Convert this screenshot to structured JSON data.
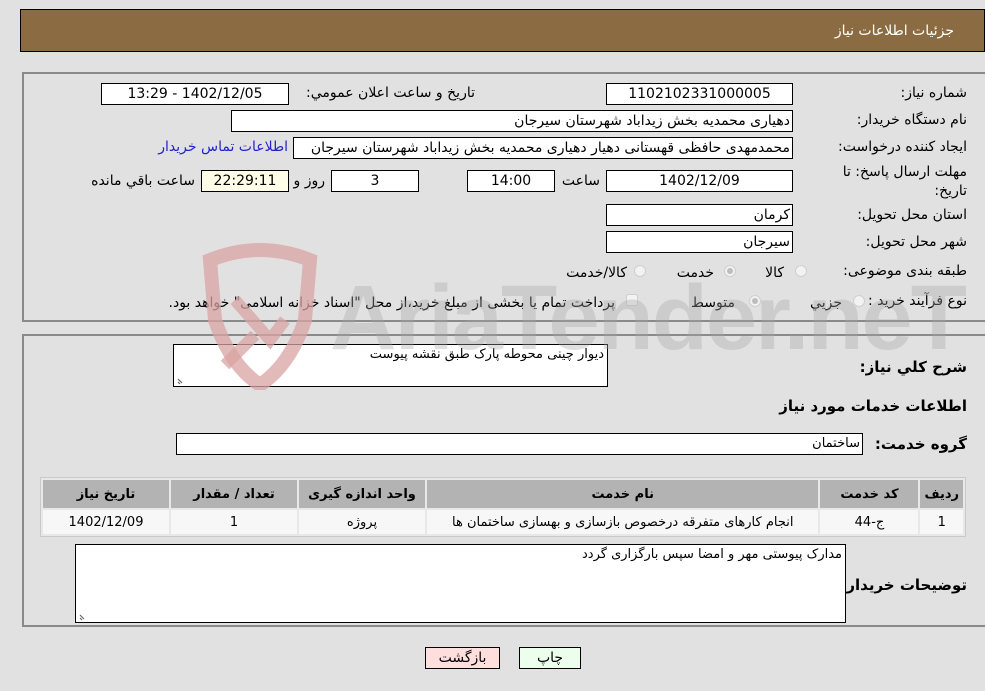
{
  "header": {
    "title": "جزئیات اطلاعات نیاز"
  },
  "form": {
    "need_number": {
      "label": "شماره نیاز:",
      "value": "1102102331000005"
    },
    "announce_datetime": {
      "label": "تاریخ و ساعت اعلان عمومي:",
      "value": "1402/12/05 - 13:29"
    },
    "buyer_org": {
      "label": "نام دستگاه خريدار:",
      "value": "دهیاری محمدیه بخش زیداباد شهرستان سیرجان"
    },
    "requester": {
      "label": "ایجاد کننده درخواست:",
      "value": "محمدمهدی حافظی قهستانی دهیار دهیاری محمدیه بخش زیداباد شهرستان سیرجان"
    },
    "buyer_contact_link": "اطلاعات تماس خریدار",
    "deadline": {
      "label": "مهلت ارسال پاسخ: تا تاریخ:",
      "date": "1402/12/09",
      "time_label": "ساعت",
      "time": "14:00",
      "days": "3",
      "days_label": "روز و",
      "remaining": "22:29:11",
      "remaining_label": "ساعت باقي مانده"
    },
    "province": {
      "label": "استان محل تحویل:",
      "value": "کرمان"
    },
    "city": {
      "label": "شهر محل تحویل:",
      "value": "سیرجان"
    },
    "category": {
      "label": "طبقه بندی موضوعی:",
      "options": [
        {
          "label": "کالا",
          "checked": false
        },
        {
          "label": "خدمت",
          "checked": true
        },
        {
          "label": "کالا/خدمت",
          "checked": false
        }
      ]
    },
    "purchase_type": {
      "label": "نوع فرآیند خرید :",
      "options": [
        {
          "label": "جزيي",
          "checked": false
        },
        {
          "label": "متوسط",
          "checked": true
        }
      ],
      "treasury_checkbox_label": "پرداخت تمام یا بخشی از مبلغ خرید،از محل \"اسناد خزانه اسلامی\" خواهد بود.",
      "treasury_checked": false
    }
  },
  "details": {
    "general_desc_label": "شرح کلي نياز:",
    "general_desc": "دیوار چینی  محوطه پارک طبق نقشه پیوست",
    "services_heading": "اطلاعات خدمات مورد نیاز",
    "service_group_label": "گروه خدمت:",
    "service_group": "ساختمان",
    "table": {
      "headers": [
        "ردیف",
        "کد خدمت",
        "نام خدمت",
        "واحد اندازه گیری",
        "تعداد / مقدار",
        "تاریخ نیاز"
      ],
      "rows": [
        [
          "1",
          "ج-44",
          "انجام کارهای متفرقه درخصوص بازسازی و بهسازی ساختمان ها",
          "پروژه",
          "1",
          "1402/12/09"
        ]
      ]
    },
    "buyer_notes_label": "توضیحات خریدار:",
    "buyer_notes": "مدارک پیوستی مهر و امضا سپس بارگزاری گردد"
  },
  "buttons": {
    "print": "چاپ",
    "back": "بازگشت"
  },
  "watermark": {
    "text": "AriaTender.neT"
  },
  "colors": {
    "header_bg": "#8b6c42",
    "link": "#2222cc",
    "print_bg": "#ecffec",
    "back_bg": "#ffdede",
    "remaining_bg": "#fefee8"
  }
}
